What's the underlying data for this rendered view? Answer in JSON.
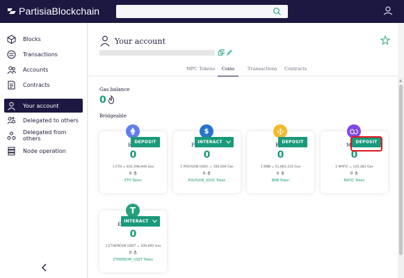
{
  "app": {
    "brand": "PartisiaBlockchain"
  },
  "search": {
    "placeholder": ""
  },
  "sidebar": {
    "items": [
      {
        "label": "Blocks",
        "icon": "cube-icon",
        "active": false
      },
      {
        "label": "Transactions",
        "icon": "transactions-icon",
        "active": false
      },
      {
        "label": "Accounts",
        "icon": "accounts-icon",
        "active": false
      },
      {
        "label": "Contracts",
        "icon": "contract-icon",
        "active": false
      },
      {
        "label": "Your account",
        "icon": "user-icon",
        "active": true
      },
      {
        "label": "Delegated to others",
        "icon": "delegated-icon",
        "active": false
      },
      {
        "label": "Delegated from others",
        "icon": "delegated-from-icon",
        "active": false
      },
      {
        "label": "Node operation",
        "icon": "server-icon",
        "active": false
      }
    ]
  },
  "account": {
    "title": "Your account",
    "tabs": [
      "MPC Tokens",
      "Coins",
      "Transactions",
      "Contracts"
    ],
    "active_tab": "Coins"
  },
  "gas": {
    "label": "Gas balance",
    "value": "0"
  },
  "bridgeable": {
    "label": "Bridgeable",
    "cards": [
      {
        "name_visible": "E",
        "icon": "ethereum-icon",
        "icon_color": "#627eea",
        "button": "DEPOSIT",
        "balance": "0",
        "rate": "1 ETH = 402,298,949 Gas",
        "gas": "0",
        "token": "ETH Token"
      },
      {
        "name_visible": "P",
        "icon": "usdc-icon",
        "icon_color": "#2775ca",
        "button": "INTERACT",
        "balance": "0",
        "rate": "1 POLYGON USDC = 100,000 Gas",
        "gas": "0",
        "token": "POLYGON_USDC Token"
      },
      {
        "name_visible": "B",
        "icon": "bnb-icon",
        "icon_color": "#f3ba2f",
        "button": "DEPOSIT",
        "balance": "0",
        "rate": "1 BNB = 51,862,233 Gas",
        "gas": "0",
        "token": "BNB Token"
      },
      {
        "name_visible": "M",
        "icon": "polygon-matic-icon",
        "icon_color": "#8247e5",
        "button": "DEPOSIT",
        "balance": "0",
        "rate": "1 MATIC = 120,383 Gas",
        "gas": "0",
        "token": "MATIC Token"
      },
      {
        "name_visible": "E",
        "icon": "tether-icon",
        "icon_color": "#26a17b",
        "button": "INTERACT",
        "balance": "0",
        "rate": "1 ETHEREUM USDT = 100,000 Gas",
        "gas": "0",
        "token": "ETHEREUM_USDT Token"
      }
    ]
  },
  "colors": {
    "brand_dark": "#1c1842",
    "accent": "#1a9a7a",
    "highlight": "#e3141c"
  }
}
